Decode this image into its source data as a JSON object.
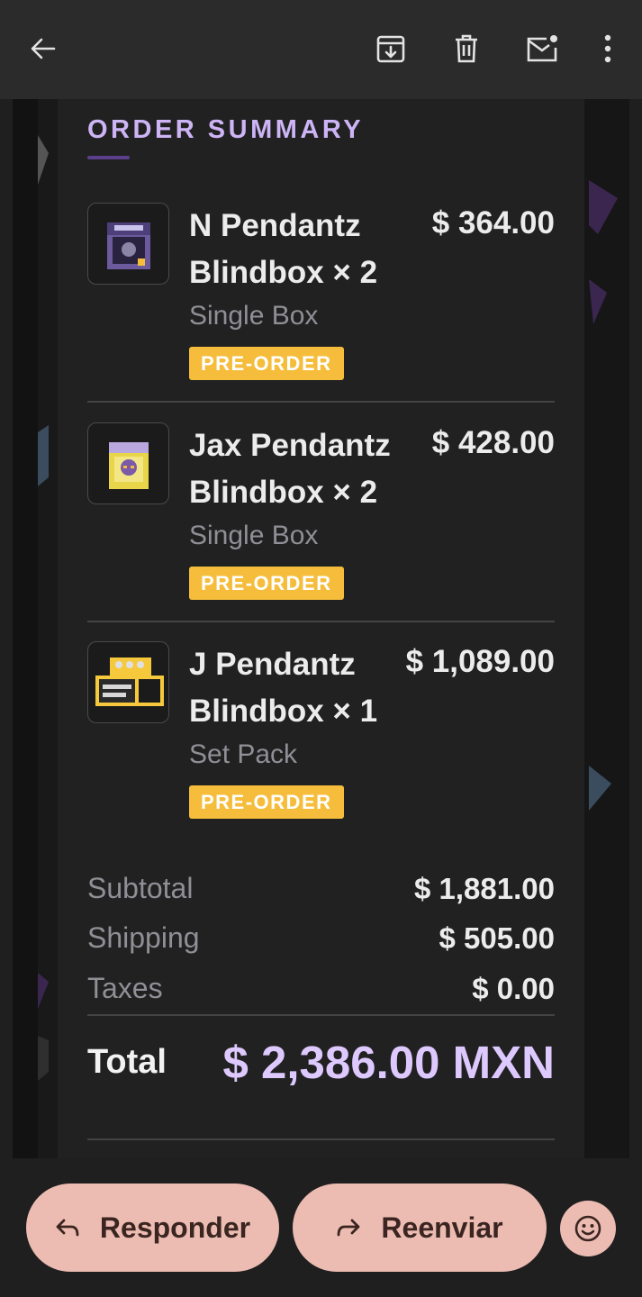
{
  "toolbar": {
    "back_icon": "arrow-left-icon",
    "archive_icon": "archive-icon",
    "delete_icon": "trash-icon",
    "mark_unread_icon": "mail-unread-icon",
    "more_icon": "more-vert-icon"
  },
  "order": {
    "section_title": "ORDER SUMMARY",
    "items": [
      {
        "name": "N Pendantz Blindbox × 2",
        "price": "$ 364.00",
        "variant": "Single Box",
        "badge": "PRE-ORDER"
      },
      {
        "name": "Jax Pendantz Blindbox × 2",
        "price": "$ 428.00",
        "variant": "Single Box",
        "badge": "PRE-ORDER"
      },
      {
        "name": "J Pendantz Blindbox × 1",
        "price": "$ 1,089.00",
        "variant": "Set Pack",
        "badge": "PRE-ORDER"
      }
    ],
    "subtotal_label": "Subtotal",
    "subtotal_value": "$ 1,881.00",
    "shipping_label": "Shipping",
    "shipping_value": "$ 505.00",
    "taxes_label": "Taxes",
    "taxes_value": "$ 0.00",
    "total_label": "Total",
    "total_value": "$ 2,386.00 MXN"
  },
  "actions": {
    "reply_label": "Responder",
    "forward_label": "Reenviar",
    "reply_icon": "reply-icon",
    "forward_icon": "forward-icon",
    "emoji_icon": "emoji-icon"
  },
  "colors": {
    "accent": "#cdb4f5",
    "badge": "#f5bd3b",
    "action_pill": "#ecbcb2",
    "card": "#212121"
  }
}
